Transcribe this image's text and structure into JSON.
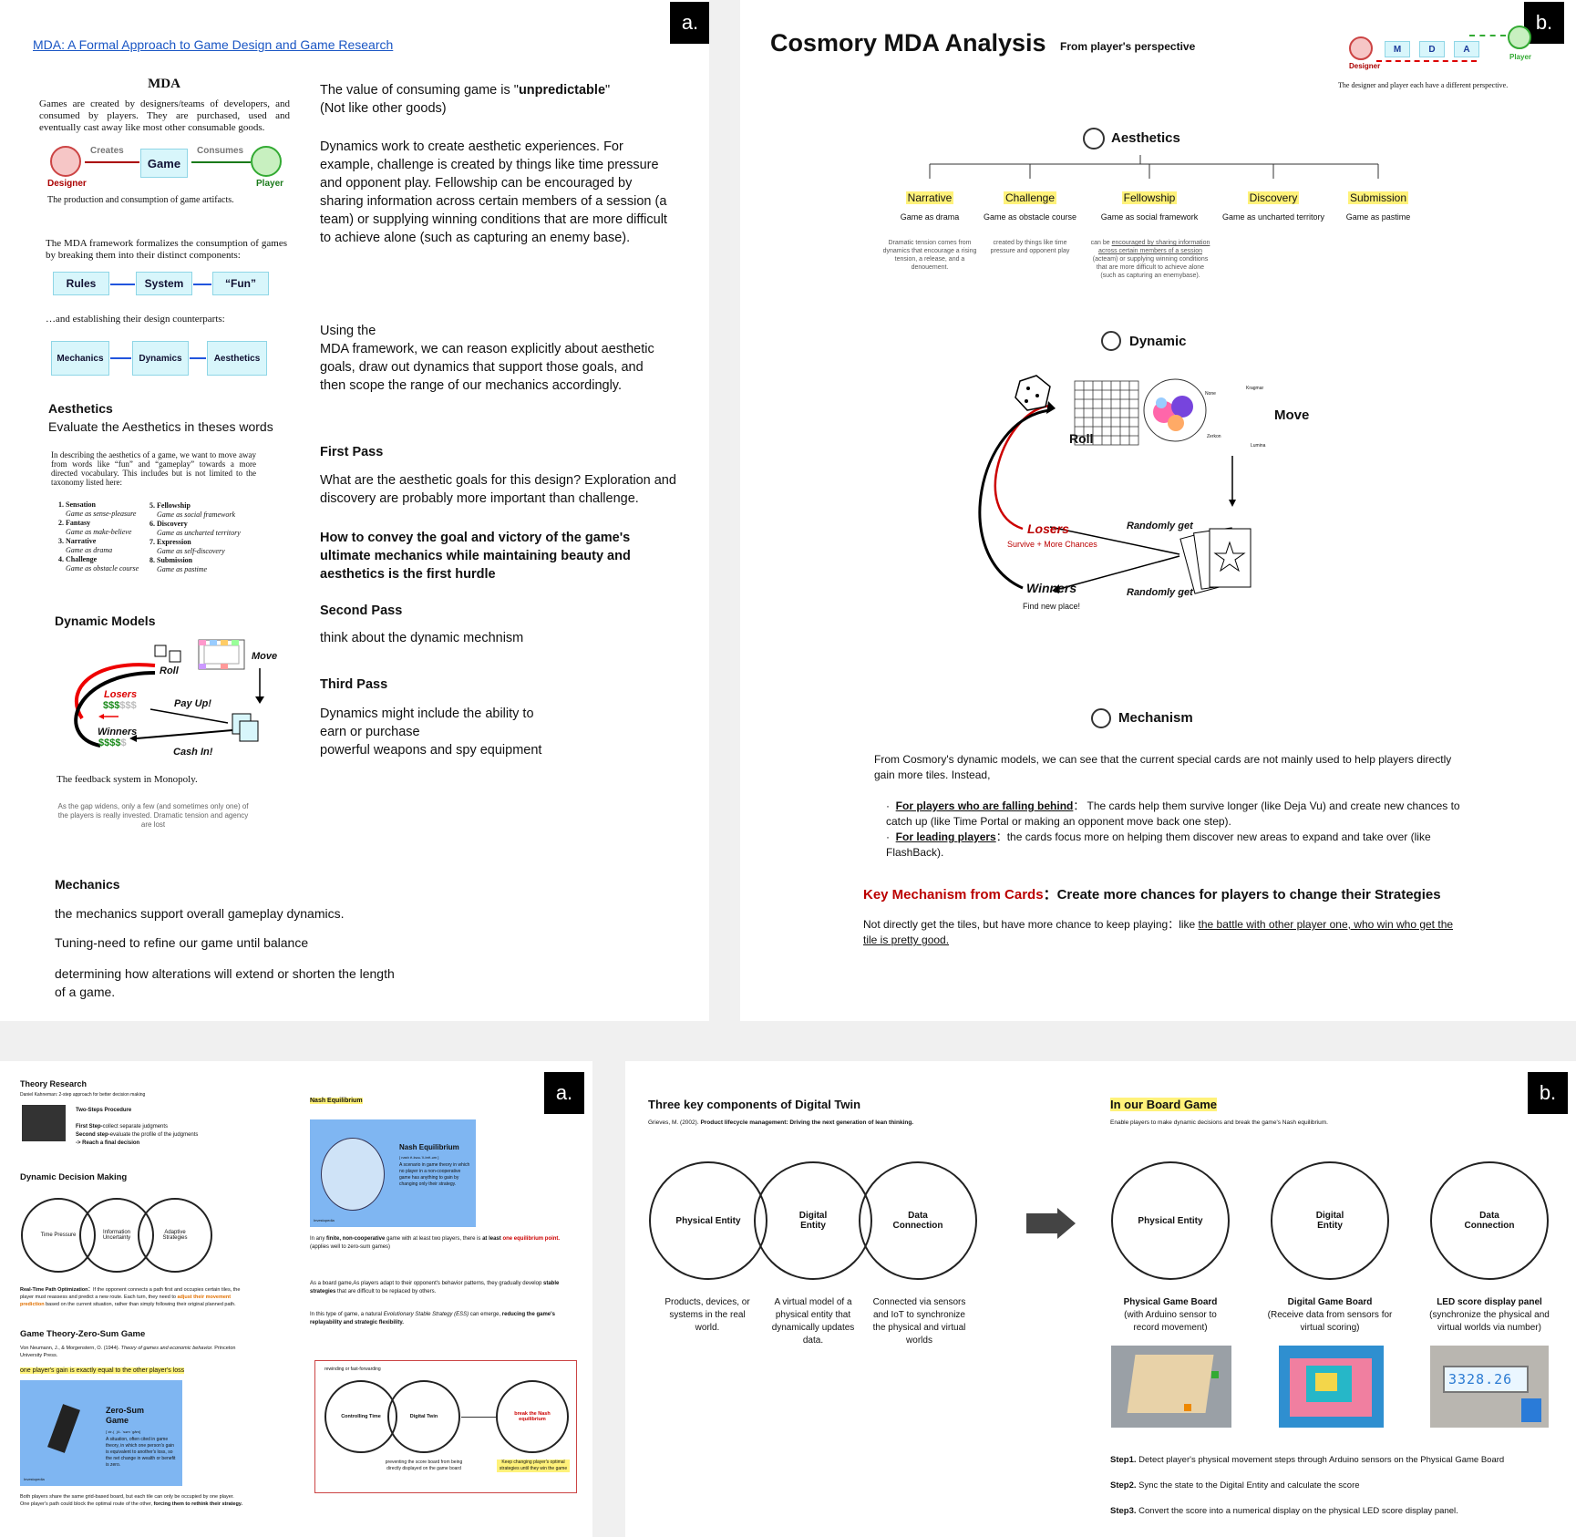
{
  "p1": {
    "tag": "a.",
    "link": "MDA: A Formal Approach to Game Design and Game Research",
    "fig_title": "MDA",
    "fig_intro": "Games are created by designers/teams of developers, and consumed by players. They are purchased, used and eventually cast away like most other consumable goods.",
    "creates": "Creates",
    "consumes": "Consumes",
    "game": "Game",
    "designer": "Designer",
    "player": "Player",
    "cap1": "The production and consumption of game artifacts.",
    "fig_text2": "The MDA framework formalizes the consumption of games by breaking them into their distinct components:",
    "rules": "Rules",
    "system": "System",
    "fun": "“Fun”",
    "counter": "…and establishing their design counterparts:",
    "mech": "Mechanics",
    "dyn": "Dynamics",
    "aes": "Aesthetics",
    "aes_head": "Aesthetics",
    "aes_sub": "Evaluate the Aesthetics in theses words",
    "tax_intro": "In describing the aesthetics of a game, we want to move away from words like “fun” and “gameplay” towards a more directed vocabulary. This includes but is not limited to the taxonomy listed here:",
    "tax_left": [
      [
        "1. Sensation",
        "Game as sense-pleasure"
      ],
      [
        "2. Fantasy",
        "Game as make-believe"
      ],
      [
        "3. Narrative",
        "Game as drama"
      ],
      [
        "4. Challenge",
        "Game as obstacle course"
      ]
    ],
    "tax_right": [
      [
        "5. Fellowship",
        "Game as social framework"
      ],
      [
        "6. Discovery",
        "Game as uncharted territory"
      ],
      [
        "7. Expression",
        "Game as self-discovery"
      ],
      [
        "8. Submission",
        "Game as pastime"
      ]
    ],
    "dm_head": "Dynamic Models",
    "roll": "Roll",
    "move": "Move",
    "losers": "Losers",
    "winners": "Winners",
    "payup": "Pay Up!",
    "cashin": "Cash In!",
    "ldol": "$$$",
    "ldol2": "$$$",
    "wdol": "$$$$",
    "wdol2": "$",
    "cap2": "The feedback system in Monopoly.",
    "gap": "As the gap widens, only a few (and sometimes only one) of the players is really invested. Dramatic tension and agency are lost",
    "mech_head": "Mechanics",
    "mech_lines": [
      "the mechanics support overall gameplay dynamics.",
      "Tuning-need to refine our game until balance",
      "determining how alterations will extend or shorten the length of a game."
    ],
    "r1a": "The value of consuming game is \"",
    "r1b": "unpredictable",
    "r1c": "\"",
    "r1d": "(Not like other goods)",
    "r2": "Dynamics work to create aesthetic experiences. For example, challenge is created by things like time pressure and opponent play. Fellowship can be encouraged by sharing information across certain members of a session (a team) or supplying winning conditions that are more difficult to achieve alone (such as capturing an enemy base).",
    "r3a": "Using the",
    "r3b": "MDA framework, we can reason explicitly about aesthetic goals, draw out dynamics that support those goals, and then scope the range of our mechanics accordingly.",
    "fp": "First Pass",
    "fp_t": "What are the aesthetic goals for this design? Exploration and discovery are probably more important than challenge.",
    "fp_b": "How to convey the goal and victory of the game's ultimate mechanics while maintaining beauty and aesthetics is the first hurdle",
    "sp": "Second Pass",
    "sp_t": "think about the dynamic mechnism",
    "tp": "Third Pass",
    "tp_t1": "Dynamics might include the ability to",
    "tp_t2": "earn or purchase",
    "tp_t3": "powerful weapons and spy equipment"
  },
  "p2": {
    "tag": "b.",
    "title": "Cosmory MDA Analysis",
    "sub": "From player's perspective",
    "mini": [
      "M",
      "D",
      "A"
    ],
    "mini_designer": "Designer",
    "mini_player": "Player",
    "mini_cap": "The designer and player each have a different perspective.",
    "aes": "Aesthetics",
    "cats": [
      {
        "n": "Narrative",
        "d": "Game as drama",
        "x": "Dramatic tension comes from dynamics that encourage a rising tension, a release, and a denouement."
      },
      {
        "n": "Challenge",
        "d": "Game as obstacle course",
        "x": "created by things like time pressure and opponent play"
      },
      {
        "n": "Fellowship",
        "d": "Game as social framework",
        "x": ""
      },
      {
        "n": "Discovery",
        "d": "Game as uncharted territory",
        "x": ""
      },
      {
        "n": "Submission",
        "d": "Game as pastime",
        "x": ""
      }
    ],
    "fel1": "can be ",
    "fel2": "encouraged by sharing information across certain members of a session",
    "fel3": " (acteam) or supplying winning conditions that are more difficult to achieve alone (such as capturing an enemybase).",
    "dyn": "Dynamic",
    "roll": "Roll",
    "move": "Move",
    "losers": "Losers",
    "losers_sub": "Survive + More Chances",
    "winners": "Winners",
    "winners_sub": "Find new place!",
    "rg1": "Randomly get",
    "rg2": "Randomly get",
    "tiny": [
      "None",
      "Kragmar",
      "Zerkon",
      "Lumina"
    ],
    "mech": "Mechanism",
    "mech_p": "From Cosmory's dynamic models, we can see that the current special cards are not mainly used to help players directly gain more tiles. Instead,",
    "b1a": "For players who are falling behind",
    "b1b": "： The cards help them survive longer (like Deja Vu) and create new chances to catch up (like Time Portal or making an opponent move back one step).",
    "b2a": "For leading players",
    "b2b": "：the cards focus more on helping them discover new areas to expand and take over (like FlashBack).",
    "key_red": "Key Mechanism from Cards",
    "key_rest": "：Create more chances for players to change their Strategies",
    "last1": "Not directly get the tiles, but have more chance to keep playing：like ",
    "last2": "the battle with other player one, who win who get the tile is pretty good."
  },
  "p3": {
    "tag": "a.",
    "theory": "Theory Research",
    "kah": "Daniel Kahneman: 2-step approach for better decision making",
    "two": "Two-Steps Procedure",
    "s1a": "First Step-",
    "s1b": "collect separate judgments",
    "s2a": "Second step-",
    "s2b": "evaluate the profile of the judgments",
    "s3": "-> Reach a final decision",
    "ddm": "Dynamic Decision Making",
    "c1": "Time Pressure",
    "c2": "Information Uncertainty",
    "c3": "Adaptive Strategies",
    "rtp_b": "Real-Time Path Optimization：",
    "rtp1": "If the opponent connects a path first and occupies certain tiles, the player must reassess and predict a new route. Each turn, they need to ",
    "rtp_o": "adjust their movement prediction",
    "rtp2": " based on the current situation, rather than simply following their original planned path.",
    "gt": "Game Theory-Zero-Sum Game",
    "vn1": "Von Neumann, J., & Morgenstern, O. (1944). ",
    "vn2": "Theory of games and economic behavior.",
    "vn3": " Princeton University Press.",
    "opg": "one player's gain is exactly equal to the other player's loss",
    "zs_t": "Zero-Sum Game",
    "zs_p": "[ˈzir-( ˌ)ō- ˈsəm ˈgām]",
    "zs_d": "A situation, often cited in game theory, in which one person's gain is equivalent to another's loss, so the net change in wealth or benefit is zero.",
    "inv": "Investopedia",
    "both1": "Both players share the same grid-based board, but each tile can only be occupied by one player.",
    "both2": "One player's path could block the optimal route of the other, ",
    "both3": "forcing them to rethink their strategy.",
    "nash": "Nash Equilibrium",
    "ne_t": "Nash Equilibrium",
    "ne_p": "[ nash ē-kwə-ˈli-brē-əm ]",
    "ne_d": "A scenario in game theory in which no player in a non-cooperative game has anything to gain by changing only their strategy.",
    "inv2": "Investopedia",
    "n1a": "In any ",
    "n1b": "finite, non-cooperative",
    "n1c": " game with at least two players, there is ",
    "n1d": "at least ",
    "n1e": "one equilibrium point.",
    "n1f": "(applies well to zero-sum games)",
    "n2a": "As a board game,As players adapt to their opponent's behavior patterns, they gradually develop ",
    "n2b": "stable strategies",
    "n2c": " that are difficult to be replaced by others.",
    "n3a": "In this type of game, a natural ",
    "n3b": "Evolutionary Stable Strategy (ESS)",
    "n3c": " can emerge, ",
    "n3d": "reducing the game's replayability and strategic flexibility.",
    "rw": "rewinding or fast-forwarding",
    "ct": "Controlling Time",
    "dt": "Digital Twin",
    "bn": "break the Nash equilibrium",
    "prev": "preventing the score board from being directly displayed on the game board",
    "keep": "Keep changing player's optimal strategies until they win the game"
  },
  "p4": {
    "tag": "b.",
    "three": "Three key components of Digital Twin",
    "gri1": "Grieves, M. (2002). ",
    "gri2": "Product lifecycle management: Driving the next generation of lean thinking.",
    "v1": "Physical Entity",
    "v2": "Digital Entity",
    "v3": "Data Connection",
    "d1": "Products, devices, or systems in the real world.",
    "d2": "A virtual model of a physical entity that dynamically updates data.",
    "d3": "Connected via sensors and IoT to synchronize the physical and virtual worlds",
    "ours": "In our Board Game",
    "ours_sub": "Enable players to make dynamic decisions and break the game's Nash equilibrium.",
    "o1": "Physical Entity",
    "o2": "Digital Entity",
    "o3": "Data Connection",
    "t1": "Physical Game Board",
    "t1s": "(with Arduino sensor to record movement)",
    "t2": "Digital Game Board",
    "t2s": "(Receive data from sensors for virtual scoring)",
    "t3": "LED score display panel",
    "t3s": "(synchronize the physical and virtual worlds via number)",
    "led": "3328.26",
    "st1a": "Step1.",
    "st1b": " Detect player's physical movement steps through Arduino sensors on the Physical Game Board",
    "st2a": "Step2.",
    "st2b": " Sync the state to the Digital Entity and calculate the score",
    "st3a": "Step3.",
    "st3b": " Convert the score into a numerical display on the physical LED score display panel."
  }
}
